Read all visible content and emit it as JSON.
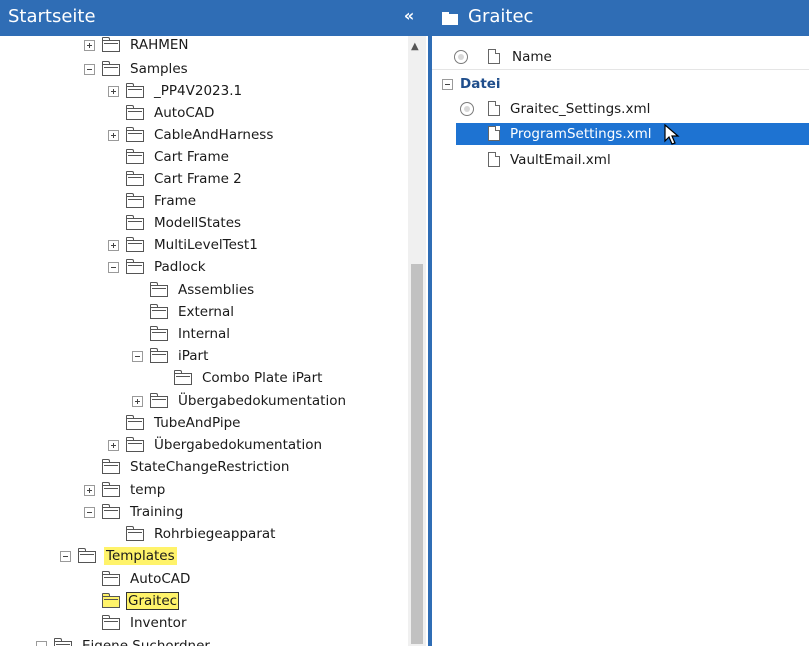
{
  "left_panel": {
    "title": "Startseite",
    "collapse_glyph": "«"
  },
  "tree": {
    "rahmen": "RAHMEN",
    "samples": "Samples",
    "pp4v": "_PP4V2023.1",
    "autocad1": "AutoCAD",
    "cable": "CableAndHarness",
    "cart": "Cart Frame",
    "cart2": "Cart Frame 2",
    "frame": "Frame",
    "modell": "ModellStates",
    "multilevel": "MultiLevelTest1",
    "padlock": "Padlock",
    "assemblies": "Assemblies",
    "external": "External",
    "internal": "Internal",
    "ipart": "iPart",
    "combo": "Combo Plate iPart",
    "uber1": "Übergabedokumentation",
    "tube": "TubeAndPipe",
    "uber2": "Übergabedokumentation",
    "statechange": "StateChangeRestriction",
    "temp": "temp",
    "training": "Training",
    "rohr": "Rohrbiegeapparat",
    "templates": "Templates",
    "autocad2": "AutoCAD",
    "graitec": "Graitec",
    "inventor": "Inventor",
    "eigene": "Eigene Suchordner"
  },
  "right_panel": {
    "title": "Graitec",
    "column_name": "Name",
    "group_label": "Datei",
    "files": [
      "Graitec_Settings.xml",
      "ProgramSettings.xml",
      "VaultEmail.xml"
    ]
  },
  "colors": {
    "header": "#2f6db5",
    "selection": "#1e73d2",
    "highlight": "#fff36a"
  }
}
